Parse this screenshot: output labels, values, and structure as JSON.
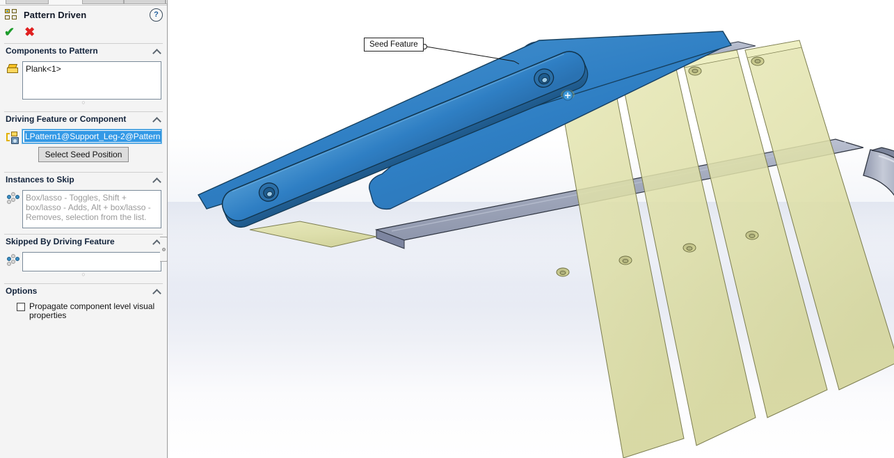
{
  "window": {
    "tabs": [
      "",
      "",
      "",
      ""
    ]
  },
  "property_manager": {
    "title": "Pattern Driven",
    "title_icon": "pattern-driven-icon",
    "help_icon": "help-icon",
    "ok_glyph": "✔",
    "cancel_glyph": "✖",
    "sections": {
      "components_to_pattern": {
        "header": "Components to Pattern",
        "icon": "component-icon",
        "value": "Plank<1>"
      },
      "driving_feature": {
        "header": "Driving Feature or Component",
        "icon": "driving-feature-icon",
        "value": "LPattern1@Support_Leg-2@Pattern",
        "button": "Select Seed Position"
      },
      "instances_to_skip": {
        "header": "Instances to Skip",
        "icon": "instances-to-skip-icon",
        "placeholder": "Box/lasso - Toggles, Shift + box/lasso - Adds, Alt + box/lasso - Removes, selection from the list."
      },
      "skipped_by_driving_feature": {
        "header": "Skipped By Driving Feature",
        "icon": "instances-to-skip-icon",
        "value": ""
      },
      "options": {
        "header": "Options",
        "checkbox_label": "Propagate component level visual properties",
        "checkbox_checked": false
      }
    }
  },
  "viewport": {
    "callout": {
      "label": "Seed Feature"
    },
    "colors": {
      "seed_highlight": "#2f7fc4",
      "plank_body": "#dedfa8",
      "support_metal": "#a9afc0",
      "background_top": "#ffffff",
      "background_mid": "#e4e8f2"
    }
  }
}
